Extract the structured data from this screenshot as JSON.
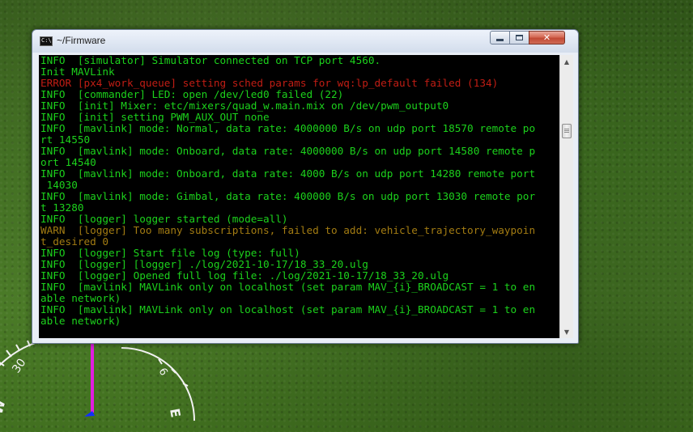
{
  "window": {
    "title": "~/Firmware",
    "icon_text": "C:\\",
    "buttons": {
      "minimize": "minimize",
      "maximize": "maximize",
      "close": "✕"
    }
  },
  "console": {
    "colors": {
      "INFO": "#1cd21c",
      "ERROR": "#c11d14",
      "WARN": "#a37c12",
      "background": "#000000"
    },
    "lines": [
      {
        "level": "INFO",
        "text": "INFO  [simulator] Simulator connected on TCP port 4560."
      },
      {
        "level": "INFO",
        "text": "Init MAVLink"
      },
      {
        "level": "ERROR",
        "text": "ERROR [px4_work_queue] setting sched params for wq:lp_default failed (134)"
      },
      {
        "level": "INFO",
        "text": "INFO  [commander] LED: open /dev/led0 failed (22)"
      },
      {
        "level": "INFO",
        "text": "INFO  [init] Mixer: etc/mixers/quad_w.main.mix on /dev/pwm_output0"
      },
      {
        "level": "INFO",
        "text": "INFO  [init] setting PWM_AUX_OUT none"
      },
      {
        "level": "INFO",
        "text": "INFO  [mavlink] mode: Normal, data rate: 4000000 B/s on udp port 18570 remote po"
      },
      {
        "level": "INFO",
        "text": "rt 14550"
      },
      {
        "level": "INFO",
        "text": "INFO  [mavlink] mode: Onboard, data rate: 4000000 B/s on udp port 14580 remote p"
      },
      {
        "level": "INFO",
        "text": "ort 14540"
      },
      {
        "level": "INFO",
        "text": "INFO  [mavlink] mode: Onboard, data rate: 4000 B/s on udp port 14280 remote port"
      },
      {
        "level": "INFO",
        "text": " 14030"
      },
      {
        "level": "INFO",
        "text": "INFO  [mavlink] mode: Gimbal, data rate: 400000 B/s on udp port 13030 remote por"
      },
      {
        "level": "INFO",
        "text": "t 13280"
      },
      {
        "level": "INFO",
        "text": "INFO  [logger] logger started (mode=all)"
      },
      {
        "level": "WARN",
        "text": "WARN  [logger] Too many subscriptions, failed to add: vehicle_trajectory_waypoin"
      },
      {
        "level": "WARN",
        "text": "t_desired 0"
      },
      {
        "level": "INFO",
        "text": "INFO  [logger] Start file log (type: full)"
      },
      {
        "level": "INFO",
        "text": "INFO  [logger] [logger] ./log/2021-10-17/18_33_20.ulg"
      },
      {
        "level": "INFO",
        "text": "INFO  [logger] Opened full log file: ./log/2021-10-17/18_33_20.ulg"
      },
      {
        "level": "INFO",
        "text": "INFO  [mavlink] MAVLink only on localhost (set param MAV_{i}_BROADCAST = 1 to en"
      },
      {
        "level": "INFO",
        "text": "able network)"
      },
      {
        "level": "INFO",
        "text": "INFO  [mavlink] MAVLink only on localhost (set param MAV_{i}_BROADCAST = 1 to en"
      },
      {
        "level": "INFO",
        "text": "able network)"
      }
    ]
  },
  "scrollbar": {
    "up": "▲",
    "down": "▼"
  },
  "hud": {
    "heading_labels": [
      "30",
      "W",
      "6",
      "E"
    ],
    "colors": {
      "axis_vertical": "#e01ee0",
      "axis_marker": "#1030ff",
      "ring": "#ffffff"
    }
  }
}
